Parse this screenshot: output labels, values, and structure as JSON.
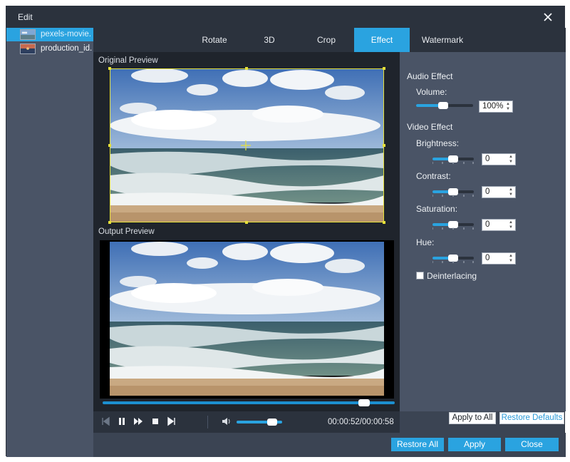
{
  "window": {
    "title": "Edit"
  },
  "files": [
    {
      "name": "pexels-movie...",
      "active": true
    },
    {
      "name": "production_id...",
      "active": false
    }
  ],
  "tabs": [
    {
      "label": "Rotate",
      "active": false
    },
    {
      "label": "3D",
      "active": false
    },
    {
      "label": "Crop",
      "active": false
    },
    {
      "label": "Effect",
      "active": true
    },
    {
      "label": "Watermark",
      "active": false
    }
  ],
  "preview": {
    "original_label": "Original Preview",
    "output_label": "Output Preview"
  },
  "playback": {
    "progress": 0.91,
    "volume": 0.85,
    "time_display": "00:00:52/00:00:58"
  },
  "audio_effect": {
    "title": "Audio Effect",
    "volume_label": "Volume:",
    "volume_value": "100%",
    "volume_level": 0.5
  },
  "video_effect": {
    "title": "Video Effect",
    "brightness_label": "Brightness:",
    "brightness_value": "0",
    "contrast_label": "Contrast:",
    "contrast_value": "0",
    "saturation_label": "Saturation:",
    "saturation_value": "0",
    "hue_label": "Hue:",
    "hue_value": "0",
    "deinterlacing_label": "Deinterlacing",
    "deinterlacing_checked": false
  },
  "panel_buttons": {
    "apply_all": "Apply to All",
    "restore_defaults": "Restore Defaults"
  },
  "footer": {
    "restore_all": "Restore All",
    "apply": "Apply",
    "close": "Close"
  },
  "colors": {
    "accent": "#2aa3e0",
    "crop": "#e5e03a"
  },
  "icons": {
    "close": "close-icon",
    "prev": "skip-previous-icon",
    "pause": "pause-icon",
    "fast_forward": "fast-forward-icon",
    "stop": "stop-icon",
    "next": "skip-next-icon",
    "speaker": "speaker-icon"
  }
}
